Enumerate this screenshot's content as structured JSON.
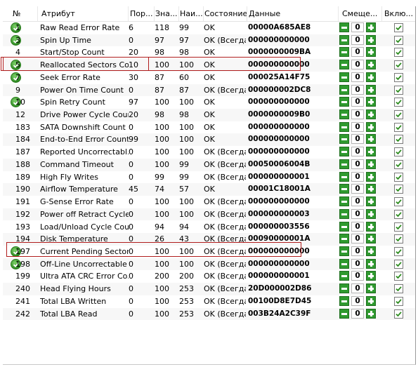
{
  "columns": {
    "num": "№",
    "attribute": "Атрибут",
    "threshold": "Пор...",
    "value": "Зна...",
    "worst": "Наи...",
    "state": "Состояние",
    "data": "Данные",
    "offset": "Смеще...",
    "enabled": "Вклю..."
  },
  "colors": {
    "highlight": "#b01c1c",
    "ok_icon": "#2e8b22",
    "button": "#2f9a2f"
  },
  "rows": [
    {
      "num": "1",
      "attr": "Raw Read Error Rate",
      "thr": "6",
      "val": "118",
      "worst": "99",
      "state": "OK",
      "data": "00000A685AE8",
      "offset": "0",
      "ok_icon": true
    },
    {
      "num": "3",
      "attr": "Spin Up Time",
      "thr": "0",
      "val": "97",
      "worst": "97",
      "state": "OK (Всегда...",
      "data": "000000000000",
      "offset": "0",
      "ok_icon": true
    },
    {
      "num": "4",
      "attr": "Start/Stop Count",
      "thr": "20",
      "val": "98",
      "worst": "98",
      "state": "OK",
      "data": "0000000009BA",
      "offset": "0",
      "ok_icon": false
    },
    {
      "num": "5",
      "attr": "Reallocated Sectors Co...",
      "thr": "10",
      "val": "100",
      "worst": "100",
      "state": "OK",
      "data": "000000000000",
      "offset": "0",
      "ok_icon": true
    },
    {
      "num": "7",
      "attr": "Seek Error Rate",
      "thr": "30",
      "val": "87",
      "worst": "60",
      "state": "OK",
      "data": "000025A14F75",
      "offset": "0",
      "ok_icon": true
    },
    {
      "num": "9",
      "attr": "Power On Time Count",
      "thr": "0",
      "val": "87",
      "worst": "87",
      "state": "OK (Всегда...",
      "data": "000000002DC8",
      "offset": "0",
      "ok_icon": false
    },
    {
      "num": "10",
      "attr": "Spin Retry Count",
      "thr": "97",
      "val": "100",
      "worst": "100",
      "state": "OK",
      "data": "000000000000",
      "offset": "0",
      "ok_icon": true
    },
    {
      "num": "12",
      "attr": "Drive Power Cycle Count",
      "thr": "20",
      "val": "98",
      "worst": "98",
      "state": "OK",
      "data": "0000000009B0",
      "offset": "0",
      "ok_icon": false
    },
    {
      "num": "183",
      "attr": "SATA Downshift Count",
      "thr": "0",
      "val": "100",
      "worst": "100",
      "state": "OK",
      "data": "000000000000",
      "offset": "0",
      "ok_icon": false
    },
    {
      "num": "184",
      "attr": "End-to-End Error Count",
      "thr": "99",
      "val": "100",
      "worst": "100",
      "state": "OK",
      "data": "000000000000",
      "offset": "0",
      "ok_icon": false
    },
    {
      "num": "187",
      "attr": "Reported Uncorrectabl...",
      "thr": "0",
      "val": "100",
      "worst": "100",
      "state": "OK (Всегда...",
      "data": "000000000000",
      "offset": "0",
      "ok_icon": false
    },
    {
      "num": "188",
      "attr": "Command Timeout",
      "thr": "0",
      "val": "100",
      "worst": "99",
      "state": "OK (Всегда...",
      "data": "00050006004B",
      "offset": "0",
      "ok_icon": false
    },
    {
      "num": "189",
      "attr": "High Fly Writes",
      "thr": "0",
      "val": "99",
      "worst": "99",
      "state": "OK (Всегда...",
      "data": "000000000001",
      "offset": "0",
      "ok_icon": false
    },
    {
      "num": "190",
      "attr": "Airflow Temperature",
      "thr": "45",
      "val": "74",
      "worst": "57",
      "state": "OK",
      "data": "00001C18001A",
      "offset": "0",
      "ok_icon": false
    },
    {
      "num": "191",
      "attr": "G-Sense Error Rate",
      "thr": "0",
      "val": "100",
      "worst": "100",
      "state": "OK (Всегда...",
      "data": "000000000000",
      "offset": "0",
      "ok_icon": false
    },
    {
      "num": "192",
      "attr": "Power off Retract Cycle ...",
      "thr": "0",
      "val": "100",
      "worst": "100",
      "state": "OK (Всегда...",
      "data": "000000000003",
      "offset": "0",
      "ok_icon": false
    },
    {
      "num": "193",
      "attr": "Load/Unload Cycle Cou...",
      "thr": "0",
      "val": "94",
      "worst": "94",
      "state": "OK (Всегда...",
      "data": "000000003556",
      "offset": "0",
      "ok_icon": false
    },
    {
      "num": "194",
      "attr": "Disk Temperature",
      "thr": "0",
      "val": "26",
      "worst": "43",
      "state": "OK (Всегда...",
      "data": "00090000001A",
      "offset": "0",
      "ok_icon": false
    },
    {
      "num": "197",
      "attr": "Current Pending Sector...",
      "thr": "0",
      "val": "100",
      "worst": "100",
      "state": "OK (Всегда...",
      "data": "000000000000",
      "offset": "0",
      "ok_icon": true
    },
    {
      "num": "198",
      "attr": "Off-Line Uncorrectable ...",
      "thr": "0",
      "val": "100",
      "worst": "100",
      "state": "OK (Всегда...",
      "data": "000000000000",
      "offset": "0",
      "ok_icon": true
    },
    {
      "num": "199",
      "attr": "Ultra ATA CRC Error Co...",
      "thr": "0",
      "val": "200",
      "worst": "200",
      "state": "OK (Всегда...",
      "data": "000000000001",
      "offset": "0",
      "ok_icon": false
    },
    {
      "num": "240",
      "attr": "Head Flying Hours",
      "thr": "0",
      "val": "100",
      "worst": "253",
      "state": "OK (Всегда...",
      "data": "20D000002D86",
      "offset": "0",
      "ok_icon": false
    },
    {
      "num": "241",
      "attr": "Total LBA Written",
      "thr": "0",
      "val": "100",
      "worst": "253",
      "state": "OK (Всегда...",
      "data": "00100D8E7D45",
      "offset": "0",
      "ok_icon": false
    },
    {
      "num": "242",
      "attr": "Total LBA Read",
      "thr": "0",
      "val": "100",
      "worst": "253",
      "state": "OK (Всегда...",
      "data": "003B24A2C39F",
      "offset": "0",
      "ok_icon": false
    }
  ]
}
